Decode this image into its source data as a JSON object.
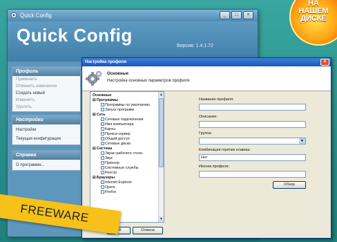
{
  "main_window": {
    "title": "Quick Config",
    "app_name": "Quick Config",
    "version": "Версия: 1.4.1.72",
    "nav_profile": {
      "header": "Профиль",
      "items": [
        "Применить",
        "Отменить изменения",
        "Создать новый",
        "Изменить",
        "Удалить"
      ]
    },
    "nav_settings": {
      "header": "Настройки",
      "items": [
        "Настройки",
        "Текущая конфигурация"
      ]
    },
    "nav_help": {
      "header": "Справка",
      "items": [
        "О программе..."
      ]
    }
  },
  "dialog": {
    "title": "Настройка профиля",
    "header_title": "Основные",
    "header_subtitle": "Настройка основных параметров профиля",
    "tree": {
      "root": "Основные",
      "items": [
        "Программы",
        "Программы по умолчанию",
        "Запуск программ",
        "Сеть",
        "Сетевые подключения",
        "Имя компьютера",
        "Карты",
        "Прокси-сервер",
        "Общий доступ",
        "Сетевые диски",
        "Система",
        "Экран рабочего стола",
        "Звук",
        "Принтер",
        "Системные службы",
        "Реестр",
        "Браузеры",
        "Internet Explorer",
        "Opera",
        "Firefox"
      ]
    },
    "form": {
      "profile_name_label": "Название профиля:",
      "profile_name_value": "",
      "description_label": "Описание:",
      "description_value": "",
      "group_label": "Группа:",
      "group_value": "",
      "hotkey_label": "Комбинация горячих клавиш:",
      "hotkey_value": "Нет",
      "icon_label": "Иконка профиля:",
      "icon_value": "",
      "browse_button": "Обзор"
    },
    "buttons": {
      "ok": "OK",
      "cancel": "Отмена"
    }
  },
  "badge": {
    "line1": "НА",
    "line2": "НАШЕМ",
    "line3": "ДИСКЕ"
  },
  "ribbon": {
    "text": "FREEWARE"
  }
}
